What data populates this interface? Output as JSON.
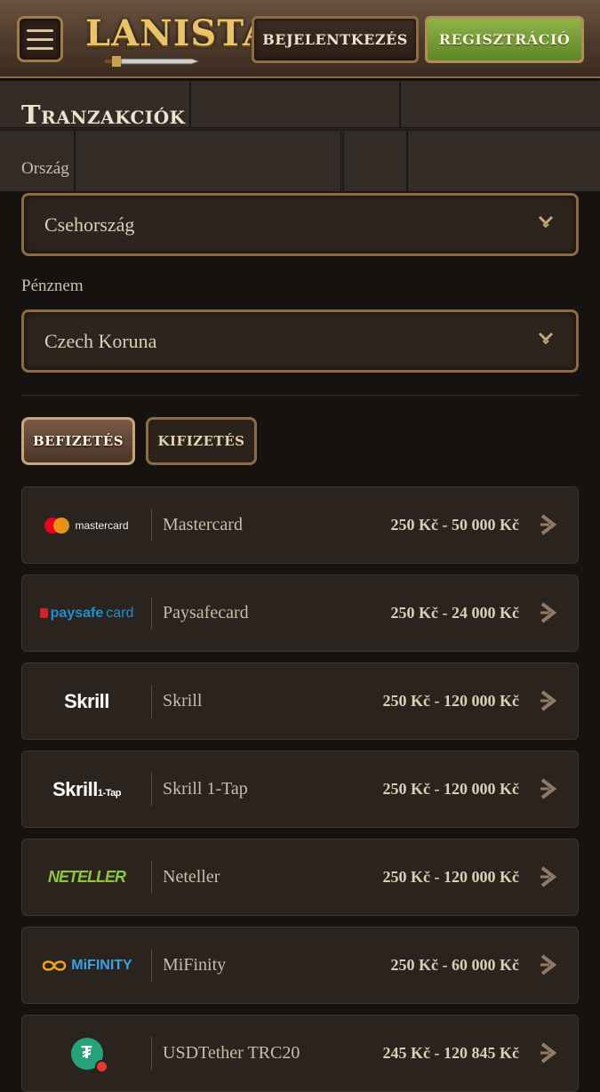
{
  "header": {
    "menu_icon": "hamburger-menu-icon",
    "logo_text": "LANISTA",
    "login_label": "BEJELENTKEZÉS",
    "register_label": "REGISZTRÁCIÓ"
  },
  "page": {
    "title": "Tranzakciók"
  },
  "filters": {
    "country_label": "Ország",
    "country_value": "Csehország",
    "currency_label": "Pénznem",
    "currency_value": "Czech Koruna"
  },
  "tabs": {
    "deposit_label": "BEFIZETÉS",
    "withdraw_label": "KIFIZETÉS",
    "active": "deposit"
  },
  "payments": [
    {
      "name": "Mastercard",
      "range": "250 Kč - 50 000 Kč",
      "logo_text": "mastercard",
      "icon": "mastercard-logo"
    },
    {
      "name": "Paysafecard",
      "range": "250 Kč - 24 000 Kč",
      "logo_text_a": "paysafe",
      "logo_text_b": "card",
      "icon": "paysafecard-logo"
    },
    {
      "name": "Skrill",
      "range": "250 Kč - 120 000 Kč",
      "logo_text": "Skrill",
      "icon": "skrill-logo"
    },
    {
      "name": "Skrill 1-Tap",
      "range": "250 Kč - 120 000 Kč",
      "logo_text": "Skrill",
      "logo_suffix": "1-Tap",
      "icon": "skrill-1tap-logo"
    },
    {
      "name": "Neteller",
      "range": "250 Kč - 120 000 Kč",
      "logo_text": "NETELLER",
      "icon": "neteller-logo"
    },
    {
      "name": "MiFinity",
      "range": "250 Kč - 60 000 Kč",
      "logo_text": "MiFINITY",
      "icon": "mifinity-logo"
    },
    {
      "name": "USDTether TRC20",
      "range": "245 Kč - 120 845 Kč",
      "icon": "usdt-tron-logo"
    }
  ],
  "colors": {
    "background": "#161210",
    "row_bg": "#2b231e",
    "accent_gold": "#8b6a45",
    "register_green": "#6f9a30"
  }
}
